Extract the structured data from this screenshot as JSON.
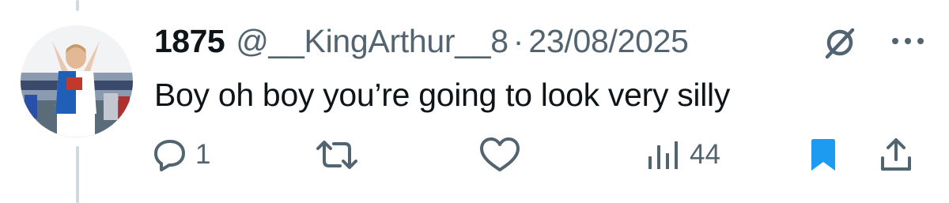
{
  "tweet": {
    "display_name": "1875",
    "handle": "@__KingArthur__8",
    "separator": "·",
    "date": "23/08/2025",
    "text": "Boy oh boy you’re going to look very silly"
  },
  "actions": {
    "reply_count": "1",
    "views_count": "44"
  },
  "icons": {
    "avatar": "avatar-photo",
    "grok": "grok-icon",
    "more": "more-icon",
    "reply": "reply-icon",
    "retweet": "retweet-icon",
    "like": "like-icon",
    "views": "views-icon",
    "bookmark": "bookmark-icon",
    "share": "share-icon"
  },
  "colors": {
    "text_primary": "#0f1419",
    "text_secondary": "#536471",
    "accent_blue": "#1d9bf0",
    "thread_line": "#cfd9de"
  }
}
